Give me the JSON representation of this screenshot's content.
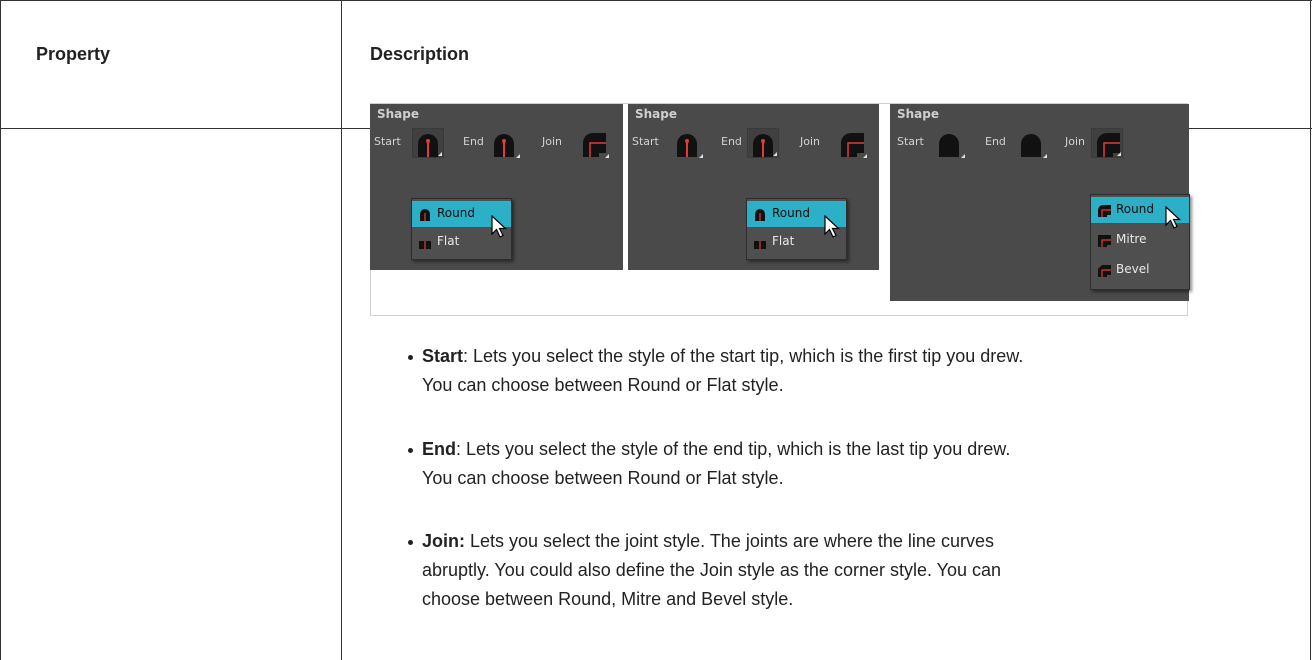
{
  "table": {
    "header": {
      "property": "Property",
      "description": "Description"
    }
  },
  "figure": {
    "panels": [
      {
        "title": "Shape",
        "labels": {
          "start": "Start",
          "end": "End",
          "join": "Join"
        },
        "dropdown": [
          "Round",
          "Flat"
        ],
        "selected": "Round"
      },
      {
        "title": "Shape",
        "labels": {
          "start": "Start",
          "end": "End",
          "join": "Join"
        },
        "dropdown": [
          "Round",
          "Flat"
        ],
        "selected": "Round"
      },
      {
        "title": "Shape",
        "labels": {
          "start": "Start",
          "end": "End",
          "join": "Join"
        },
        "dropdown": [
          "Round",
          "Mitre",
          "Bevel"
        ],
        "selected": "Round"
      }
    ],
    "colors": {
      "panel_bg": "#4a4a4a",
      "highlight": "#2bb0c8",
      "accent_red": "#e23b3b"
    }
  },
  "bullets": [
    {
      "term": "Start",
      "sep": ": ",
      "line1": "Lets you select the style of the start tip, which is the first tip you drew.",
      "line2": "You can choose between Round or Flat style."
    },
    {
      "term": "End",
      "sep": ": ",
      "line1": "Lets you select the style of the end tip, which is the last tip you drew.",
      "line2": "You can choose between Round or Flat style."
    },
    {
      "term": "Join:",
      "sep": " ",
      "line1": "Lets you select the joint style. The joints are where the line curves",
      "line2": "abruptly. You could also define the Join style as the corner style. You can",
      "line3": "choose between Round, Mitre and Bevel style."
    }
  ]
}
